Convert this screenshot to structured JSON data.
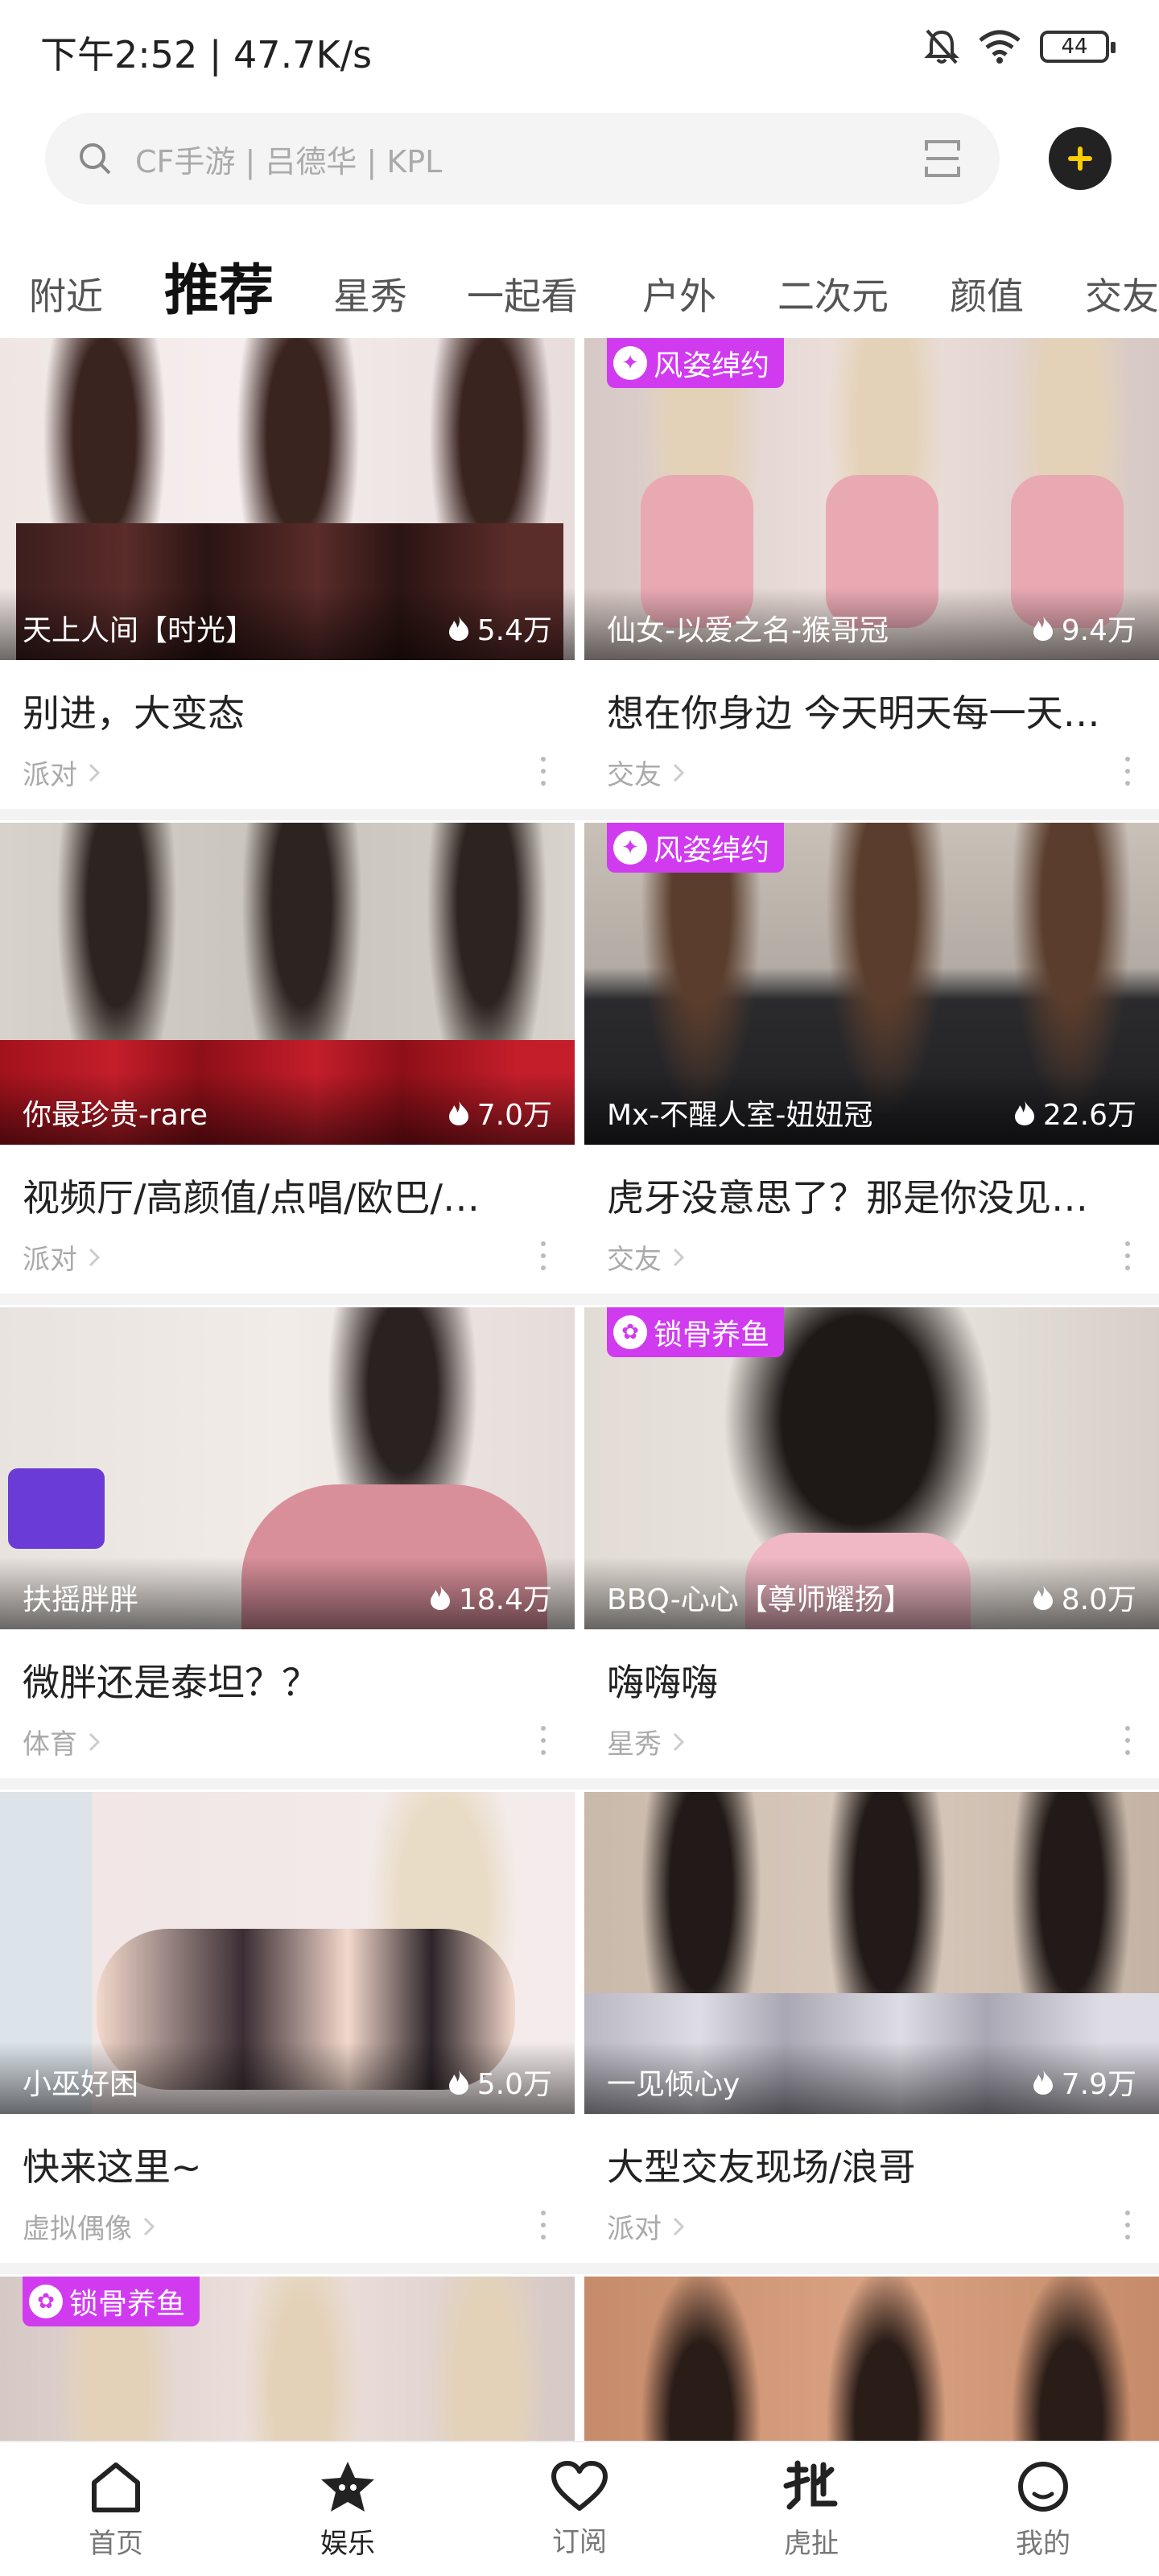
{
  "status": {
    "time": "下午2:52 | 47.7K/s",
    "battery": "44"
  },
  "search": {
    "placeholder": "CF手游 | 吕德华 | KPL"
  },
  "tabs": [
    {
      "label": "附近"
    },
    {
      "label": "推荐"
    },
    {
      "label": "星秀"
    },
    {
      "label": "一起看"
    },
    {
      "label": "户外"
    },
    {
      "label": "二次元"
    },
    {
      "label": "颜值"
    },
    {
      "label": "交友"
    }
  ],
  "cards": [
    {
      "streamer": "天上人间【时光】",
      "viewers": "5.4万",
      "title": "别进，大变态",
      "category": "派对",
      "badge": ""
    },
    {
      "streamer": "仙女-以爱之名-猴哥冠",
      "viewers": "9.4万",
      "title": "想在你身边 今天明天每一天…",
      "category": "交友",
      "badge": "风姿绰约"
    },
    {
      "streamer": "你最珍贵-rare",
      "viewers": "7.0万",
      "title": "视频厅/高颜值/点唱/欧巴/…",
      "category": "派对",
      "badge": ""
    },
    {
      "streamer": "Mx-不醒人室-妞妞冠",
      "viewers": "22.6万",
      "title": "虎牙没意思了？那是你没见…",
      "category": "交友",
      "badge": "风姿绰约"
    },
    {
      "streamer": "扶摇胖胖",
      "viewers": "18.4万",
      "title": "微胖还是泰坦？？",
      "category": "体育",
      "badge": ""
    },
    {
      "streamer": "BBQ-心心【尊师耀扬】",
      "viewers": "8.0万",
      "title": "嗨嗨嗨",
      "category": "星秀",
      "badge": "锁骨养鱼"
    },
    {
      "streamer": "小巫好困",
      "viewers": "5.0万",
      "title": "快来这里~",
      "category": "虚拟偶像",
      "badge": ""
    },
    {
      "streamer": "一见倾心y",
      "viewers": "7.9万",
      "title": "大型交友现场/浪哥",
      "category": "派对",
      "badge": ""
    },
    {
      "streamer": "",
      "viewers": "",
      "title": "",
      "category": "",
      "badge": "锁骨养鱼"
    },
    {
      "streamer": "",
      "viewers": "",
      "title": "",
      "category": "",
      "badge": ""
    }
  ],
  "nav": [
    {
      "label": "首页"
    },
    {
      "label": "娱乐"
    },
    {
      "label": "订阅"
    },
    {
      "label": "虎扯"
    },
    {
      "label": "我的"
    }
  ],
  "colors": {
    "accent": "#FFCC00",
    "badge": "#D13BF0",
    "background": "#FFFFFF"
  }
}
